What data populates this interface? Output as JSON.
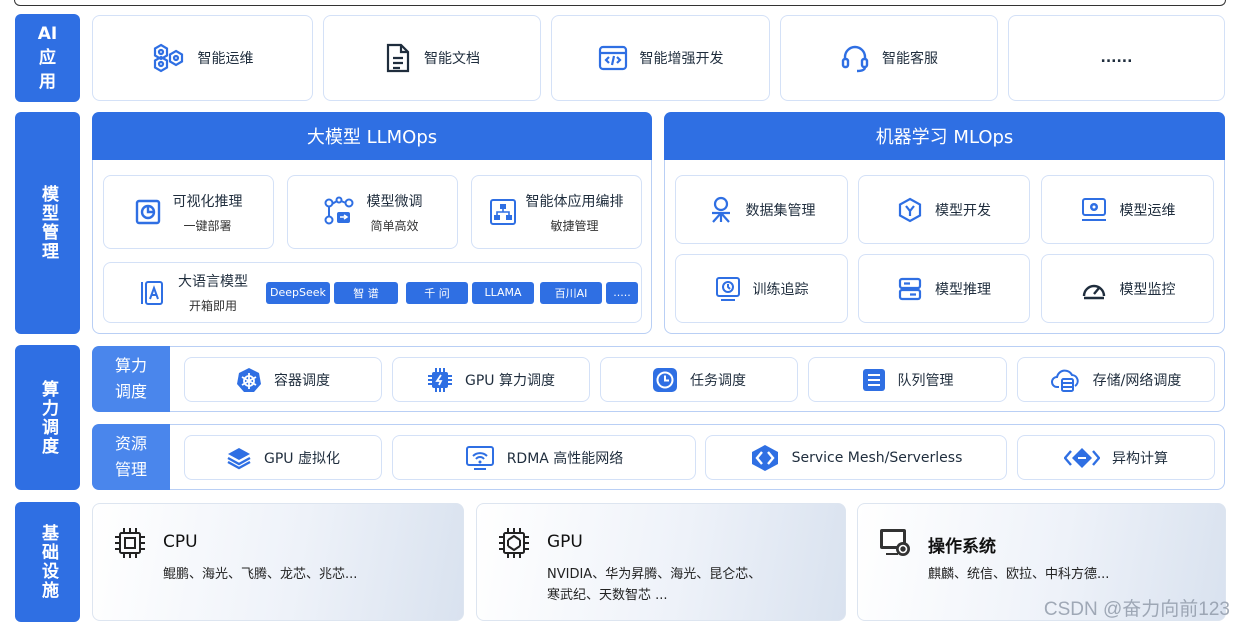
{
  "layers": {
    "ai_app": "AI 应用",
    "model_mgmt": "模型管理",
    "compute": "算力调度",
    "infra": "基础设施"
  },
  "ai_apps": [
    "智能运维",
    "智能文档",
    "智能增强开发",
    "智能客服",
    "......"
  ],
  "llmops": {
    "title": "大模型 LLMOps",
    "cards": [
      {
        "title": "可视化推理",
        "sub": "一键部署"
      },
      {
        "title": "模型微调",
        "sub": "简单高效"
      },
      {
        "title": "智能体应用编排",
        "sub": "敏捷管理"
      }
    ],
    "llm": {
      "title": "大语言模型",
      "sub": "开箱即用"
    },
    "models": [
      "DeepSeek",
      "智 谱",
      "千 问",
      "LLAMA",
      "百川AI",
      "....."
    ]
  },
  "mlops": {
    "title": "机器学习 MLOps",
    "items": [
      "数据集管理",
      "模型开发",
      "模型运维",
      "训练追踪",
      "模型推理",
      "模型监控"
    ]
  },
  "scheduling": {
    "head": "算力调度",
    "items": [
      "容器调度",
      "GPU 算力调度",
      "任务调度",
      "队列管理",
      "存储/网络调度"
    ]
  },
  "resources": {
    "head": "资源管理",
    "items": [
      "GPU 虚拟化",
      "RDMA 高性能网络",
      "Service Mesh/Serverless",
      "异构计算"
    ]
  },
  "infrastructure": [
    {
      "title": "CPU",
      "desc1": "鲲鹏、海光、飞腾、龙芯、兆芯...",
      "desc2": ""
    },
    {
      "title": "GPU",
      "desc1": "NVIDIA、华为昇腾、海光、昆仑芯、",
      "desc2": "寒武纪、天数智芯 ..."
    },
    {
      "title": "操作系统",
      "desc1": "麒麟、统信、欧拉、中科方德...",
      "desc2": ""
    }
  ],
  "watermark": "CSDN @奋力向前123",
  "colors": {
    "primary": "#2f6fe3",
    "accent": "#4a86ec",
    "border": "#b9cff5"
  }
}
